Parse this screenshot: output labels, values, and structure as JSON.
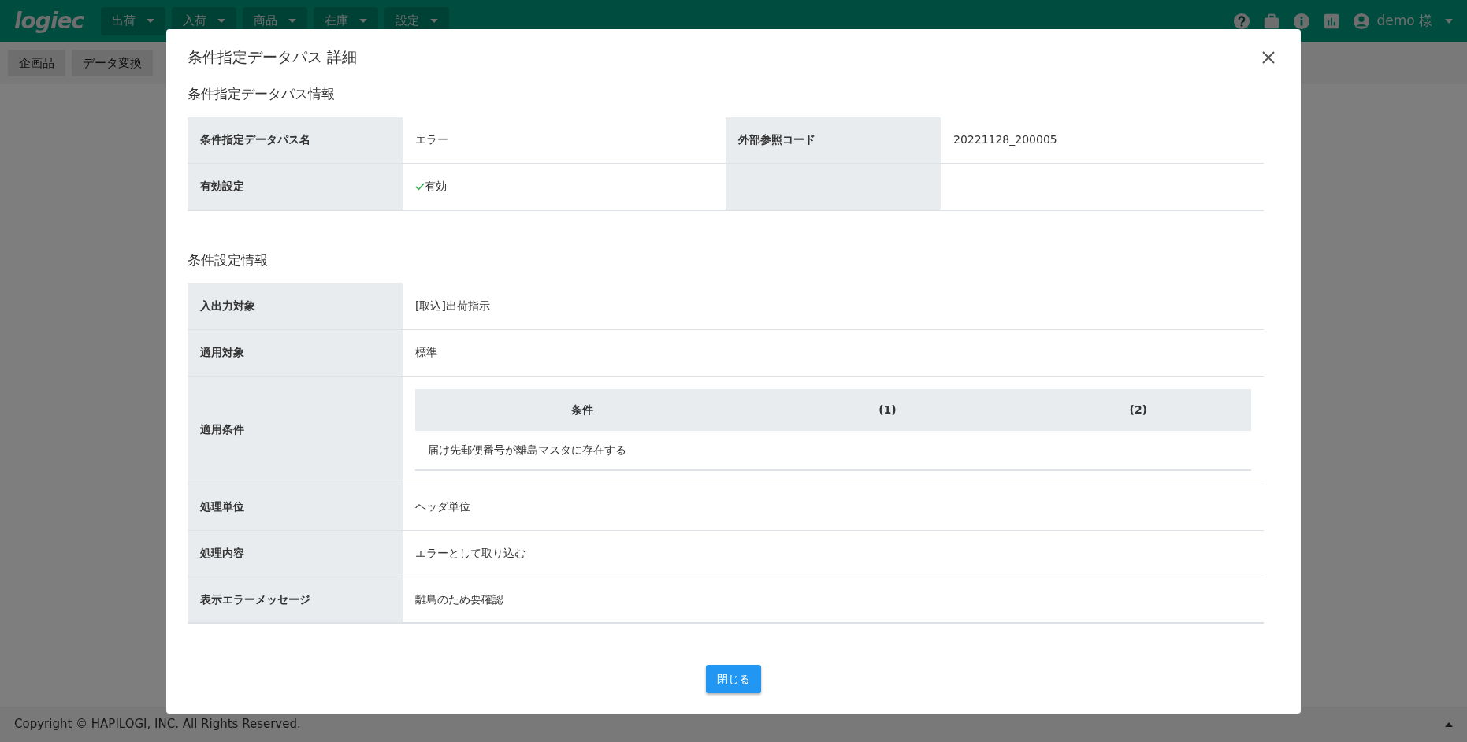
{
  "navbar": {
    "logo": "logiec",
    "menus": [
      {
        "label": "出荷"
      },
      {
        "label": "入荷"
      },
      {
        "label": "商品"
      },
      {
        "label": "在庫"
      },
      {
        "label": "設定"
      }
    ],
    "user": "demo 様"
  },
  "subbar": {
    "buttons": [
      "企画品",
      "データ変換"
    ]
  },
  "modal": {
    "title": "条件指定データパス 詳細",
    "info_section": {
      "title": "条件指定データパス情報",
      "rows": [
        [
          {
            "label": "条件指定データパス名",
            "value": "エラー"
          },
          {
            "label": "外部参照コード",
            "value": "20221128_200005"
          }
        ],
        [
          {
            "label": "有効設定",
            "value": "有効",
            "enabled": true
          }
        ]
      ]
    },
    "condition_section": {
      "title": "条件設定情報",
      "rows": [
        {
          "kind": "text",
          "label": "入出力対象",
          "value": "[取込]出荷指示"
        },
        {
          "kind": "text",
          "label": "適用対象",
          "value": "標準"
        },
        {
          "kind": "table",
          "label": "適用条件",
          "columns": [
            "条件",
            "(1)",
            "(2)"
          ],
          "rows": [
            [
              "届け先郵便番号が離島マスタに存在する"
            ]
          ]
        },
        {
          "kind": "text",
          "label": "処理単位",
          "value": "ヘッダ単位"
        },
        {
          "kind": "text",
          "label": "処理内容",
          "value": "エラーとして取り込む"
        },
        {
          "kind": "text",
          "label": "表示エラーメッセージ",
          "value": "離島のため要確認"
        }
      ]
    },
    "close_button": "閉じる"
  },
  "footer": {
    "copyright": "Copyright © HAPILOGI, INC. All Rights Reserved."
  }
}
